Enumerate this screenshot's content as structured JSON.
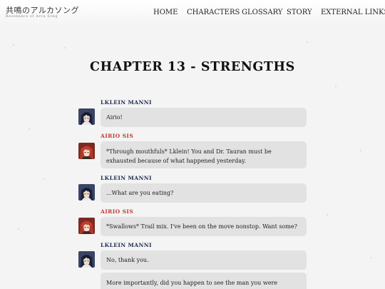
{
  "header": {
    "logo_text": "共鳴のアルカソング",
    "logo_subtitle": "Resonance of Arca Song",
    "nav": [
      {
        "label": "HOME"
      },
      {
        "label": "CHARACTERS"
      },
      {
        "label": "GLOSSARY"
      },
      {
        "label": "STORY"
      },
      {
        "label": "EXTERNAL LINKS"
      }
    ]
  },
  "chapter": {
    "title": "CHAPTER 13 - STRENGTHS"
  },
  "colors": {
    "lklein_name": "#1f2d52",
    "airio_name": "#c0392b",
    "bubble": "#e2e2e2",
    "background": "#f4f4f4"
  },
  "dialogue": [
    {
      "speaker": "LKLEIN MANNI",
      "character": "lklein",
      "text": "Airio!"
    },
    {
      "speaker": "AIRIO SIS",
      "character": "airio",
      "text": "*Through mouthfuls* Lklein! You and Dr. Tauran must be exhausted because of what happened yesterday."
    },
    {
      "speaker": "LKLEIN MANNI",
      "character": "lklein",
      "text": "...What are you eating?"
    },
    {
      "speaker": "AIRIO SIS",
      "character": "airio",
      "text": "*Swallows* Trail mix. I've been on the move nonstop. Want some?"
    },
    {
      "speaker": "LKLEIN MANNI",
      "character": "lklein",
      "text": "No, thank you."
    },
    {
      "speaker": "",
      "character": "lklein",
      "text": "More importantly, did you happen to see the man you were fighting last night?"
    }
  ]
}
